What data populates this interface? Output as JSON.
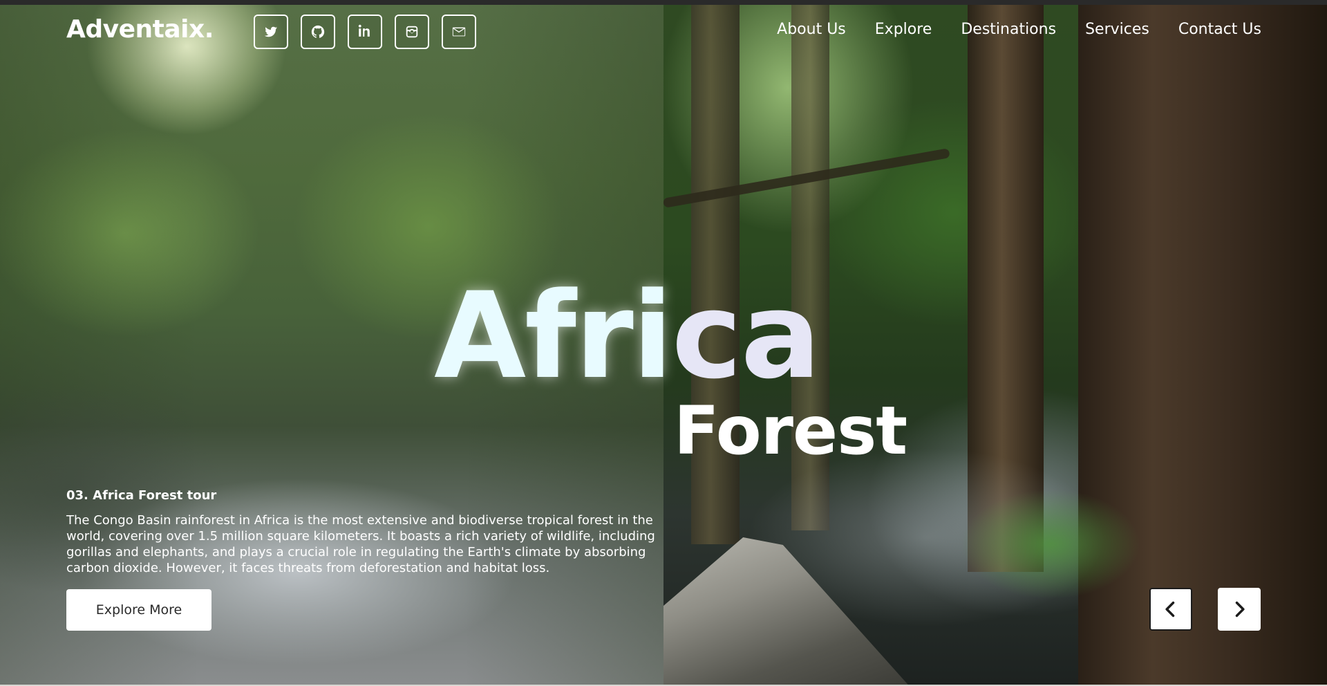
{
  "brand": {
    "logo": "Adventaix."
  },
  "socials": [
    {
      "name": "twitter-icon"
    },
    {
      "name": "github-icon"
    },
    {
      "name": "linkedin-icon"
    },
    {
      "name": "instagram-icon"
    },
    {
      "name": "mail-icon"
    }
  ],
  "nav": {
    "items": [
      "About Us",
      "Explore",
      "Destinations",
      "Services",
      "Contact Us"
    ]
  },
  "hero": {
    "title_part1": "Afri",
    "title_part2": "ca",
    "subtitle": "Forest",
    "tour_title": "03. Africa Forest tour",
    "description": "The Congo Basin rainforest in Africa is the most extensive and biodiverse tropical forest in the world, covering over 1.5 million square kilometers. It boasts a rich variety of wildlife, including gorillas and elephants, and plays a crucial role in regulating the Earth's climate by absorbing carbon dioxide. However, it faces threats from deforestation and habitat loss.",
    "cta_label": "Explore More"
  },
  "carousel": {
    "prev_icon": "chevron-left-icon",
    "next_icon": "chevron-right-icon"
  },
  "colors": {
    "title_glow": "#e8fbff",
    "button_bg": "#ffffff",
    "button_text": "#2a2a2a"
  }
}
